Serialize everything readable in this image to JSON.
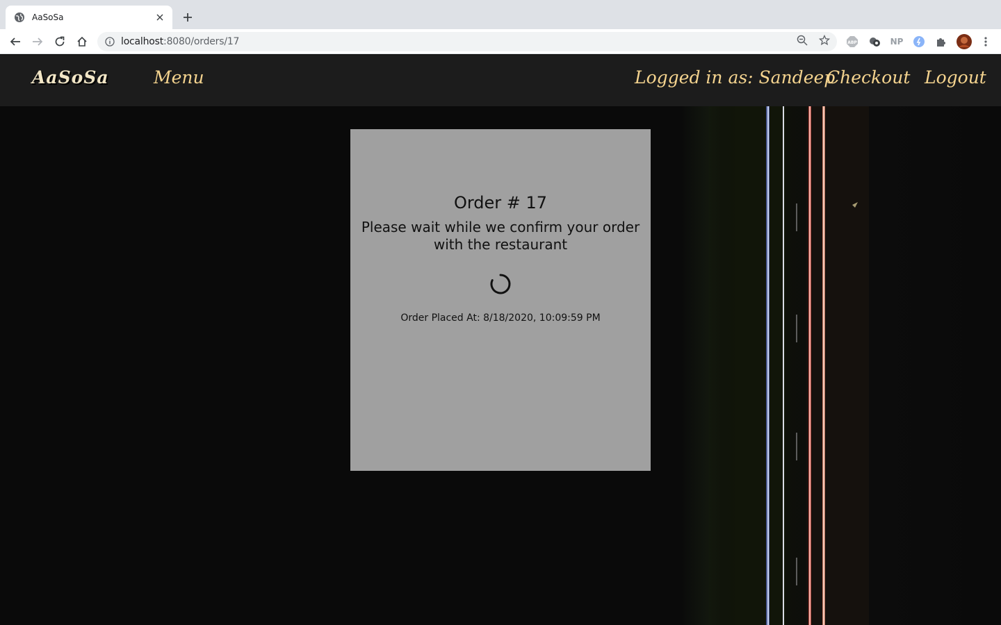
{
  "browser": {
    "tab_title": "AaSoSa",
    "url_host": "localhost",
    "url_path": ":8080/orders/17",
    "extensions": [
      "ABP",
      "NP"
    ]
  },
  "header": {
    "brand": "AaSoSa",
    "menu": "Menu",
    "logged_in": "Logged in as: Sandeep",
    "checkout": "Checkout",
    "logout": "Logout"
  },
  "order": {
    "title": "Order # 17",
    "message": "Please wait while we confirm your order with the restaurant",
    "placed_at": "Order Placed At: 8/18/2020, 10:09:59 PM"
  },
  "colors": {
    "header_bg": "#1c1c1c",
    "accent": "#f5d48f",
    "card_bg": "#a0a0a0",
    "page_bg": "#0a0a0a"
  }
}
